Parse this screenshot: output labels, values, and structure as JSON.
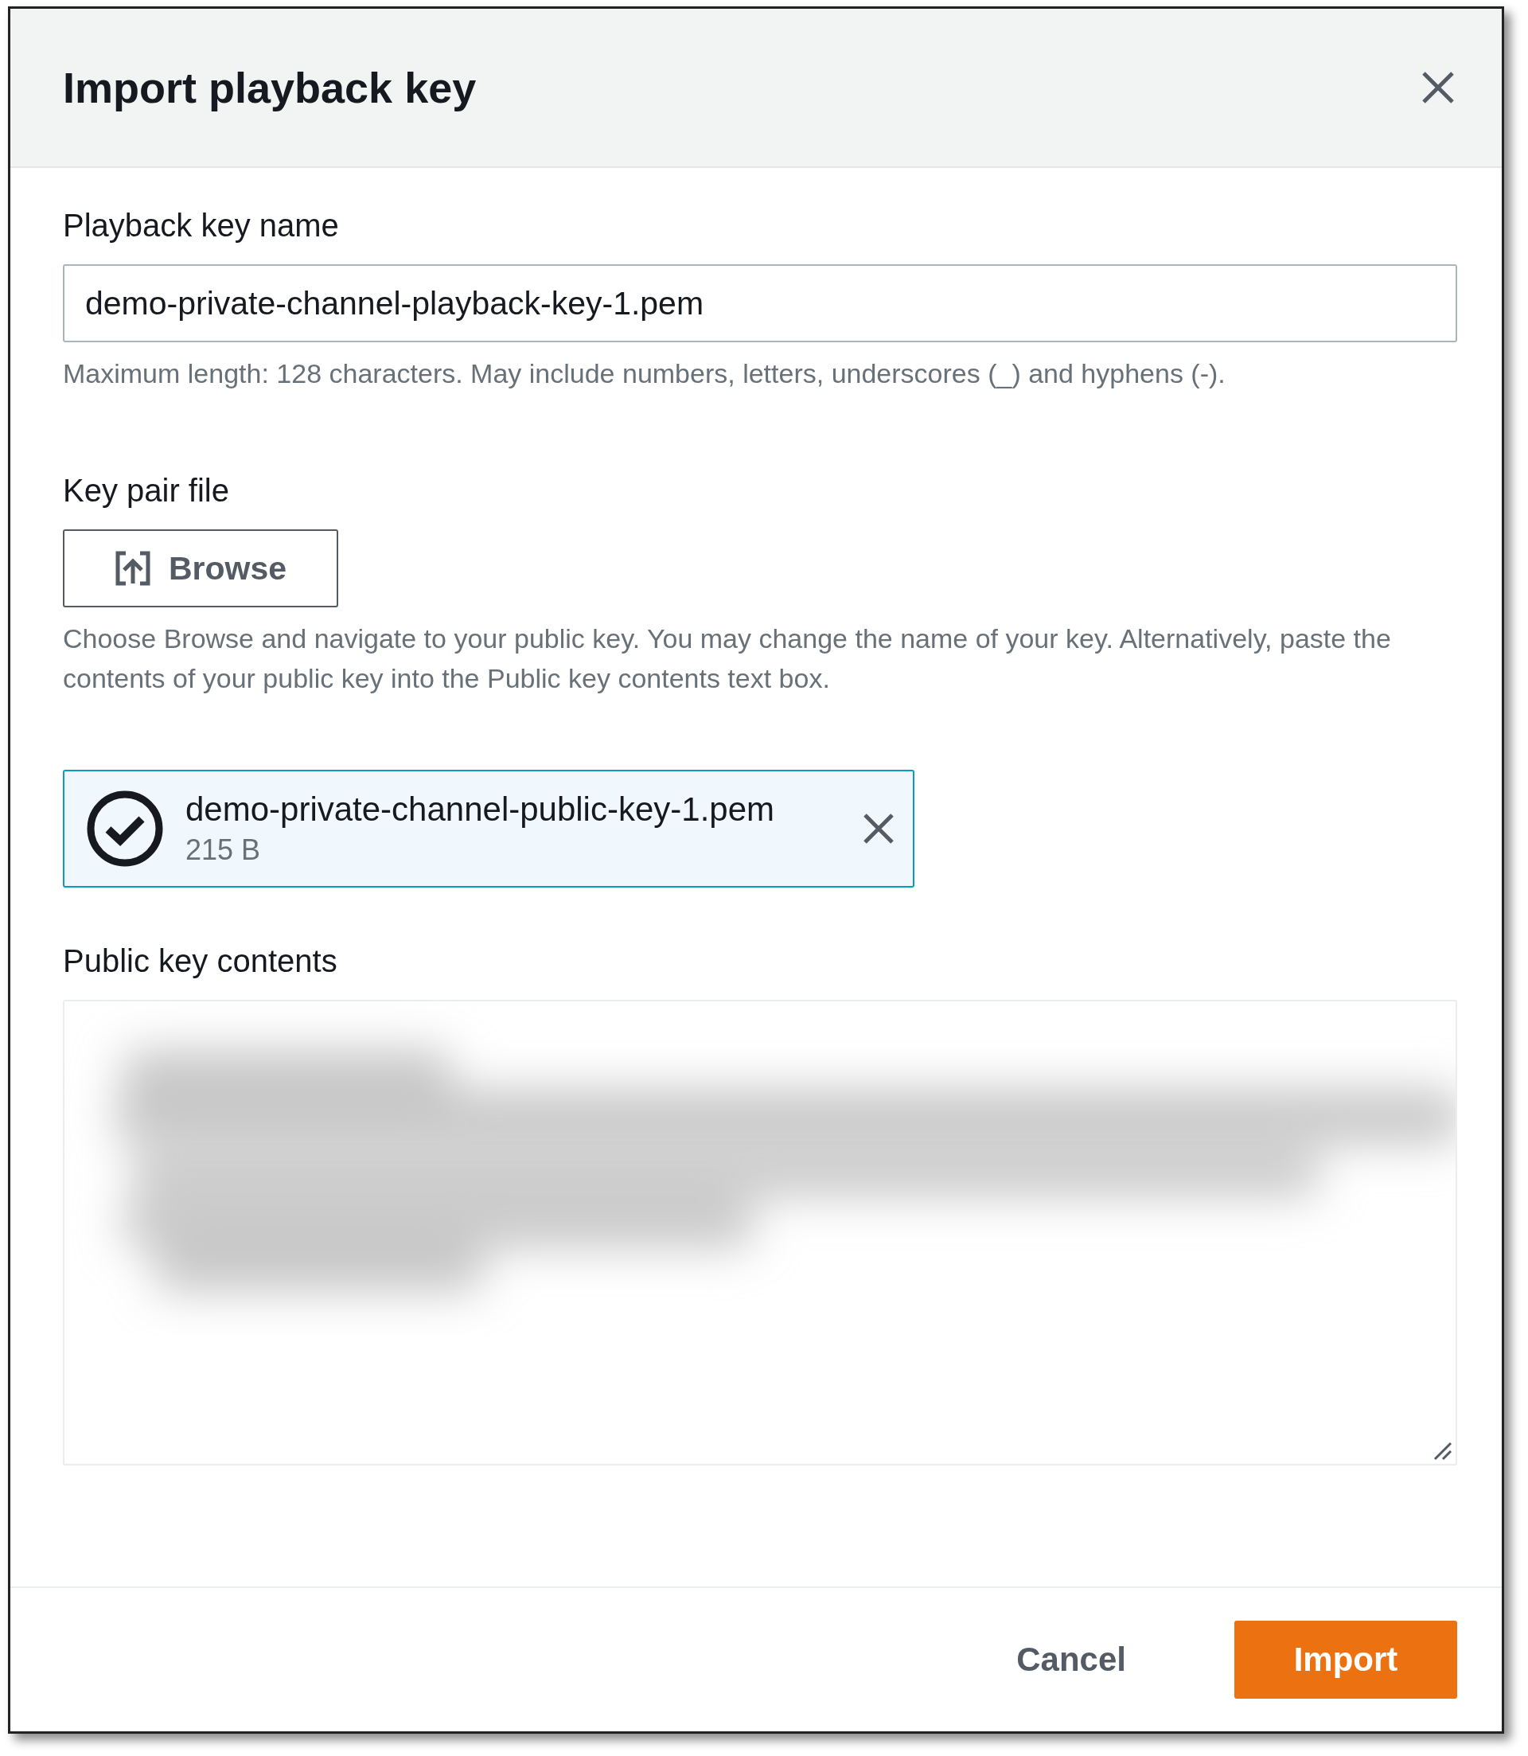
{
  "dialog": {
    "title": "Import playback key"
  },
  "name_field": {
    "label": "Playback key name",
    "value": "demo-private-channel-playback-key-1.pem",
    "hint": "Maximum length: 128 characters. May include numbers, letters, underscores (_) and hyphens (-)."
  },
  "key_pair_file": {
    "label": "Key pair file",
    "browse_button": "Browse",
    "hint": "Choose Browse and navigate to your public key. You may change the name of your key. Alternatively, paste the contents of your public key into the Public key contents text box.",
    "file": {
      "name": "demo-private-channel-public-key-1.pem",
      "size": "215 B",
      "selected": true
    }
  },
  "public_key_contents": {
    "label": "Public key contents"
  },
  "buttons": [
    {
      "label": "Cancel",
      "kind": "secondary"
    },
    {
      "label": "Import",
      "kind": "primary"
    }
  ]
}
